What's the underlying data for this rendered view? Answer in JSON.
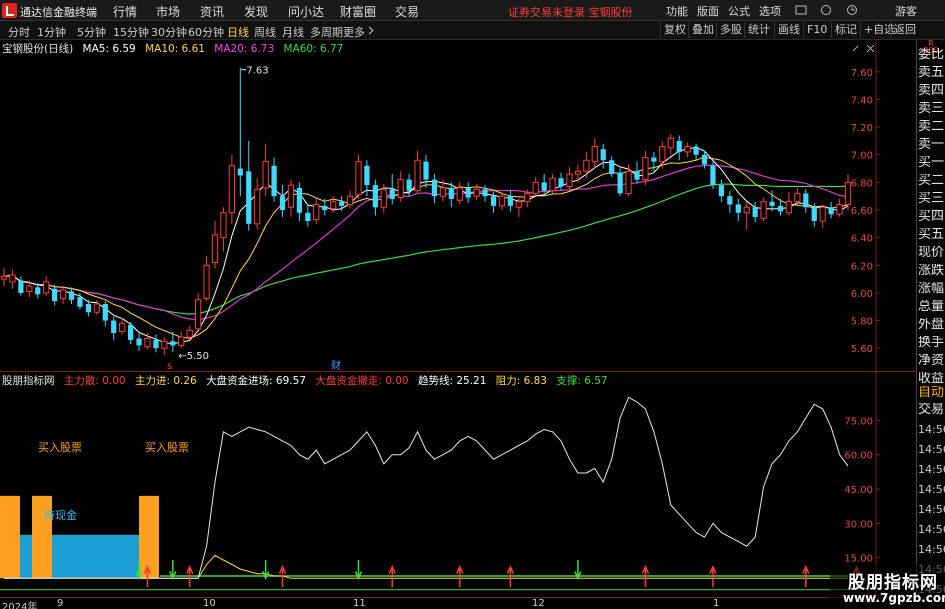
{
  "menubar": {
    "brand": "通达信金融终端",
    "items": [
      "行情",
      "市场",
      "资讯",
      "发现",
      "问小达",
      "财富圈",
      "交易"
    ],
    "notice": "证券交易未登录  宝钢股份",
    "right_buttons": [
      "功能",
      "版面",
      "公式",
      "选项"
    ],
    "user": "游客"
  },
  "toolbar": {
    "periods": [
      "分时",
      "1分钟",
      "5分钟",
      "15分钟",
      "30分钟",
      "60分钟",
      "日线",
      "周线",
      "月线",
      "多周期",
      "更多"
    ],
    "active_period": "日线",
    "right_buttons": [
      "复权",
      "叠加",
      "多股",
      "统计",
      "画线",
      "F10",
      "标记",
      "+自选",
      "返回"
    ]
  },
  "price_pane": {
    "stock_label": "宝钢股份(日线)",
    "ma": [
      {
        "label": "MA5: 6.59",
        "color": "#ffffff"
      },
      {
        "label": "MA10: 6.61",
        "color": "#ffd84a"
      },
      {
        "label": "MA20: 6.73",
        "color": "#ff3cf0"
      },
      {
        "label": "MA60: 6.77",
        "color": "#3ddc3d"
      }
    ],
    "high_label": "7.63",
    "low_label": "5.50",
    "event_marker": "财",
    "event_marker_s": "s"
  },
  "indicator_pane": {
    "title": "股朋指标网",
    "fields": [
      {
        "label": "主力散: 0.00",
        "color": "#ff3b3b"
      },
      {
        "label": "主力进: 0.26",
        "color": "#ffd84a"
      },
      {
        "label": "大盘资金进场: 69.57",
        "color": "#ffffff"
      },
      {
        "label": "大盘资金撤走: 0.00",
        "color": "#ff3b3b"
      },
      {
        "label": "趋势线: 25.21",
        "color": "#ffffff"
      },
      {
        "label": "阻力: 6.83",
        "color": "#ffd84a"
      },
      {
        "label": "支撑: 6.57",
        "color": "#3ddc3d"
      }
    ],
    "buy_label_1": "买入股票",
    "buy_label_2": "买入股票",
    "cash_label": "持现金",
    "ticks": [
      "75.00",
      "60.00",
      "45.00",
      "30.00",
      "15.00"
    ]
  },
  "sidebar": {
    "header_top": "R",
    "header_bottom": "300",
    "items": [
      "委比",
      "卖五",
      "卖四",
      "卖三",
      "卖二",
      "卖一",
      "买一",
      "买二",
      "买三",
      "买四",
      "买五",
      "现价",
      "涨跌",
      "涨幅",
      "总量",
      "外盘",
      "换手",
      "净资",
      "收益"
    ],
    "tabs": [
      "自动",
      "交易"
    ],
    "times": [
      "14:56",
      "14:56",
      "14:56",
      "14:56",
      "14:56",
      "14:56",
      "14:56",
      "14:56",
      "14:56"
    ]
  },
  "date_axis": {
    "labels": [
      "2024年",
      "9",
      "10",
      "11",
      "12",
      "1"
    ]
  },
  "watermark": {
    "title": "股朋指标网",
    "url": "www.7gpzb.com"
  },
  "colors": {
    "up": "#ff3b3b",
    "down": "#3fd8ff",
    "ma5": "#ffffff",
    "ma10": "#ffd84a",
    "ma20": "#d83ccf",
    "ma60": "#3ddc3d",
    "axis_red": "#7a1f1f",
    "buy_bar": "#ffa020",
    "cash_bar": "#1b9ed6"
  },
  "chart_data": [
    {
      "type": "candlestick",
      "title": "宝钢股份(日线)",
      "y_ticks": [
        7.6,
        7.4,
        7.2,
        7.0,
        6.8,
        6.6,
        6.4,
        6.2,
        6.0,
        5.8,
        5.6
      ],
      "ylim": [
        5.5,
        7.7
      ],
      "x_labels": [
        "2024年",
        "9",
        "10",
        "11",
        "12",
        "1"
      ],
      "ohlc": [
        [
          6.1,
          6.12,
          6.18,
          6.05
        ],
        [
          6.08,
          6.13,
          6.17,
          6.03
        ],
        [
          6.09,
          6.0,
          6.12,
          5.98
        ],
        [
          6.01,
          6.05,
          6.09,
          5.97
        ],
        [
          6.04,
          5.99,
          6.07,
          5.96
        ],
        [
          6.0,
          6.08,
          6.12,
          5.98
        ],
        [
          6.03,
          5.94,
          6.06,
          5.91
        ],
        [
          5.96,
          6.02,
          6.05,
          5.92
        ],
        [
          6.01,
          5.95,
          6.04,
          5.92
        ],
        [
          5.97,
          5.9,
          6.0,
          5.88
        ],
        [
          5.92,
          5.86,
          5.95,
          5.83
        ],
        [
          5.86,
          5.92,
          5.95,
          5.84
        ],
        [
          5.92,
          5.8,
          5.94,
          5.76
        ],
        [
          5.8,
          5.71,
          5.83,
          5.66
        ],
        [
          5.72,
          5.78,
          5.82,
          5.7
        ],
        [
          5.77,
          5.66,
          5.79,
          5.63
        ],
        [
          5.67,
          5.62,
          5.71,
          5.58
        ],
        [
          5.61,
          5.67,
          5.71,
          5.59
        ],
        [
          5.66,
          5.6,
          5.7,
          5.57
        ],
        [
          5.6,
          5.65,
          5.68,
          5.55
        ],
        [
          5.65,
          5.62,
          5.72,
          5.57
        ],
        [
          5.62,
          5.68,
          5.72,
          5.6
        ],
        [
          5.68,
          5.73,
          5.76,
          5.66
        ],
        [
          5.74,
          5.95,
          6.0,
          5.73
        ],
        [
          5.96,
          6.2,
          6.27,
          5.94
        ],
        [
          6.22,
          6.42,
          6.52,
          6.18
        ],
        [
          6.4,
          6.58,
          6.62,
          6.3
        ],
        [
          6.58,
          6.92,
          7.0,
          6.5
        ],
        [
          6.9,
          6.85,
          7.63,
          6.7
        ],
        [
          6.88,
          6.5,
          7.1,
          6.45
        ],
        [
          6.5,
          6.75,
          6.83,
          6.46
        ],
        [
          6.76,
          6.95,
          7.08,
          6.7
        ],
        [
          6.92,
          6.7,
          6.98,
          6.66
        ],
        [
          6.7,
          6.6,
          6.78,
          6.55
        ],
        [
          6.62,
          6.78,
          6.82,
          6.55
        ],
        [
          6.76,
          6.58,
          6.8,
          6.52
        ],
        [
          6.58,
          6.52,
          6.64,
          6.48
        ],
        [
          6.53,
          6.64,
          6.68,
          6.5
        ],
        [
          6.63,
          6.6,
          6.68,
          6.56
        ],
        [
          6.61,
          6.66,
          6.7,
          6.58
        ],
        [
          6.66,
          6.63,
          6.7,
          6.59
        ],
        [
          6.64,
          6.7,
          6.74,
          6.61
        ],
        [
          6.71,
          6.95,
          7.0,
          6.68
        ],
        [
          6.92,
          6.78,
          6.96,
          6.7
        ],
        [
          6.78,
          6.62,
          6.82,
          6.56
        ],
        [
          6.62,
          6.75,
          6.79,
          6.58
        ],
        [
          6.75,
          6.68,
          6.86,
          6.64
        ],
        [
          6.69,
          6.82,
          6.88,
          6.66
        ],
        [
          6.82,
          6.74,
          6.86,
          6.7
        ],
        [
          6.74,
          6.96,
          7.03,
          6.72
        ],
        [
          6.95,
          6.82,
          7.0,
          6.76
        ],
        [
          6.82,
          6.7,
          6.86,
          6.65
        ],
        [
          6.7,
          6.76,
          6.82,
          6.66
        ],
        [
          6.76,
          6.68,
          6.8,
          6.62
        ],
        [
          6.67,
          6.76,
          6.8,
          6.64
        ],
        [
          6.76,
          6.69,
          6.8,
          6.65
        ],
        [
          6.7,
          6.75,
          6.79,
          6.67
        ],
        [
          6.75,
          6.7,
          6.78,
          6.66
        ],
        [
          6.7,
          6.63,
          6.73,
          6.58
        ],
        [
          6.63,
          6.7,
          6.73,
          6.6
        ],
        [
          6.7,
          6.63,
          6.74,
          6.59
        ],
        [
          6.62,
          6.66,
          6.7,
          6.55
        ],
        [
          6.66,
          6.72,
          6.75,
          6.62
        ],
        [
          6.72,
          6.8,
          6.84,
          6.7
        ],
        [
          6.8,
          6.74,
          6.86,
          6.72
        ],
        [
          6.74,
          6.83,
          6.86,
          6.72
        ],
        [
          6.83,
          6.77,
          6.87,
          6.74
        ],
        [
          6.77,
          6.86,
          6.91,
          6.74
        ],
        [
          6.86,
          6.88,
          6.93,
          6.8
        ],
        [
          6.88,
          6.96,
          7.02,
          6.83
        ],
        [
          6.95,
          7.06,
          7.12,
          6.9
        ],
        [
          7.04,
          6.96,
          7.08,
          6.9
        ],
        [
          6.96,
          6.86,
          6.99,
          6.84
        ],
        [
          6.87,
          6.72,
          6.9,
          6.7
        ],
        [
          6.72,
          6.88,
          6.93,
          6.7
        ],
        [
          6.88,
          6.82,
          6.95,
          6.79
        ],
        [
          6.82,
          6.98,
          7.03,
          6.78
        ],
        [
          6.98,
          6.95,
          7.02,
          6.88
        ],
        [
          6.95,
          7.06,
          7.1,
          6.9
        ],
        [
          7.05,
          7.12,
          7.15,
          7.0
        ],
        [
          7.1,
          7.02,
          7.14,
          6.96
        ],
        [
          7.02,
          7.06,
          7.09,
          6.98
        ],
        [
          7.06,
          7.0,
          7.08,
          6.96
        ],
        [
          7.0,
          6.93,
          7.03,
          6.9
        ],
        [
          6.92,
          6.78,
          6.95,
          6.75
        ],
        [
          6.78,
          6.7,
          6.82,
          6.66
        ],
        [
          6.7,
          6.64,
          6.74,
          6.58
        ],
        [
          6.64,
          6.58,
          6.68,
          6.52
        ],
        [
          6.58,
          6.62,
          6.66,
          6.46
        ],
        [
          6.62,
          6.55,
          6.66,
          6.51
        ],
        [
          6.54,
          6.66,
          6.69,
          6.52
        ],
        [
          6.66,
          6.63,
          6.74,
          6.59
        ],
        [
          6.63,
          6.59,
          6.68,
          6.56
        ],
        [
          6.58,
          6.66,
          6.73,
          6.56
        ],
        [
          6.66,
          6.72,
          6.76,
          6.64
        ],
        [
          6.72,
          6.62,
          6.75,
          6.58
        ],
        [
          6.62,
          6.52,
          6.65,
          6.48
        ],
        [
          6.52,
          6.62,
          6.64,
          6.47
        ],
        [
          6.62,
          6.57,
          6.66,
          6.54
        ],
        [
          6.57,
          6.64,
          6.68,
          6.55
        ],
        [
          6.64,
          6.8,
          6.86,
          6.6
        ]
      ]
    },
    {
      "type": "line",
      "title": "股朋指标网",
      "yticks": [
        75.0,
        60.0,
        45.0,
        30.0,
        15.0
      ],
      "ylim": [
        0,
        90
      ],
      "trend_line": [
        6,
        6,
        6,
        6,
        6,
        6,
        6,
        6,
        6,
        6,
        6,
        6,
        6,
        6,
        6,
        6,
        6,
        6,
        6,
        6,
        6,
        6,
        6,
        6,
        20,
        48,
        70,
        68,
        70,
        72,
        71,
        70,
        68,
        66,
        64,
        60,
        58,
        62,
        56,
        58,
        60,
        62,
        66,
        70,
        64,
        56,
        60,
        60,
        63,
        70,
        62,
        58,
        60,
        62,
        66,
        68,
        66,
        62,
        58,
        60,
        62,
        64,
        66,
        69,
        71,
        70,
        66,
        58,
        52,
        52,
        54,
        48,
        58,
        76,
        85,
        83,
        80,
        70,
        56,
        38,
        34,
        30,
        26,
        24,
        30,
        26,
        24,
        22,
        20,
        24,
        46,
        56,
        60,
        66,
        70,
        76,
        82,
        80,
        72,
        60,
        55
      ],
      "trend_line_2": [
        6,
        6,
        6,
        6,
        6,
        6,
        6,
        6,
        6,
        6,
        6,
        6,
        6,
        6,
        6,
        6,
        6,
        6,
        6,
        6,
        6,
        6,
        6,
        6,
        12,
        16,
        14,
        12,
        10,
        9,
        8,
        8,
        7,
        7,
        6,
        6,
        6,
        6,
        6,
        6,
        6,
        6,
        6,
        6,
        6,
        6,
        6,
        6,
        6,
        6,
        6,
        6,
        6,
        6,
        6,
        6,
        6,
        6,
        6,
        6,
        6,
        6,
        6,
        6,
        6,
        6,
        6,
        6,
        6,
        6,
        6,
        6,
        6,
        6,
        6,
        6,
        6,
        6,
        6,
        6,
        6,
        6,
        6,
        6,
        6,
        6,
        6,
        6,
        6,
        6,
        6,
        6,
        6,
        6,
        6,
        6,
        6,
        6,
        6,
        6,
        6
      ],
      "buy_zones": [
        [
          0,
          2
        ],
        [
          2,
          4
        ],
        [
          11,
          13
        ]
      ],
      "cash_zone": [
        1,
        11
      ],
      "green_down_arrows": [
        16,
        20,
        31,
        42,
        68
      ],
      "red_up_arrows": [
        17,
        22,
        33,
        46,
        54,
        60,
        76,
        84,
        95,
        101
      ]
    }
  ]
}
